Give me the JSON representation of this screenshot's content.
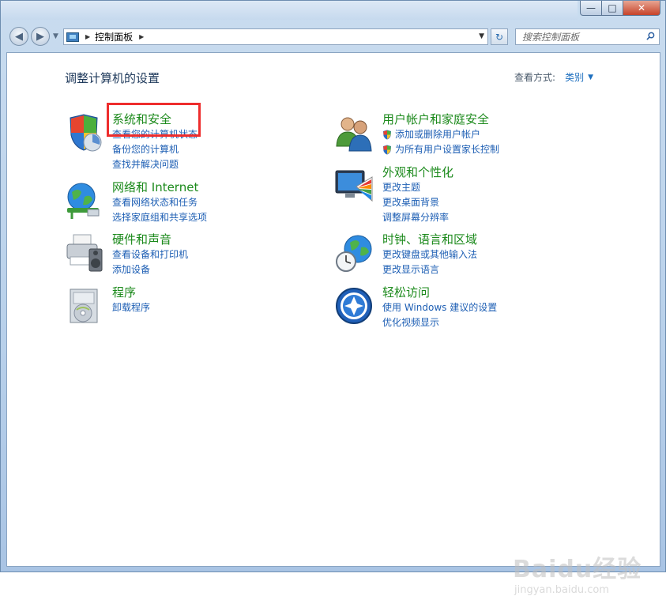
{
  "window": {
    "caption_buttons": {
      "minimize_icon": "minimize-icon",
      "maximize_icon": "maximize-icon",
      "close_icon": "close-icon"
    }
  },
  "address_bar": {
    "location": "控制面板",
    "location_icon": "control-panel-icon"
  },
  "search": {
    "placeholder": "搜索控制面板"
  },
  "main": {
    "title": "调整计算机的设置",
    "view_by_label": "查看方式:",
    "view_by_value": "类别"
  },
  "categories": [
    {
      "title": "系统和安全",
      "icon": "shield-icon",
      "links": [
        {
          "label": "查看您的计算机状态",
          "shield": false
        },
        {
          "label": "备份您的计算机",
          "shield": false
        },
        {
          "label": "查找并解决问题",
          "shield": false
        }
      ]
    },
    {
      "title": "网络和 Internet",
      "icon": "network-globe-icon",
      "links": [
        {
          "label": "查看网络状态和任务",
          "shield": false
        },
        {
          "label": "选择家庭组和共享选项",
          "shield": false
        }
      ]
    },
    {
      "title": "硬件和声音",
      "icon": "printer-speaker-icon",
      "links": [
        {
          "label": "查看设备和打印机",
          "shield": false
        },
        {
          "label": "添加设备",
          "shield": false
        }
      ]
    },
    {
      "title": "程序",
      "icon": "programs-disc-icon",
      "links": [
        {
          "label": "卸载程序",
          "shield": false
        }
      ]
    },
    {
      "title": "用户帐户和家庭安全",
      "icon": "users-icon",
      "links": [
        {
          "label": "添加或删除用户帐户",
          "shield": true
        },
        {
          "label": "为所有用户设置家长控制",
          "shield": true
        }
      ]
    },
    {
      "title": "外观和个性化",
      "icon": "monitor-palette-icon",
      "links": [
        {
          "label": "更改主题",
          "shield": false
        },
        {
          "label": "更改桌面背景",
          "shield": false
        },
        {
          "label": "调整屏幕分辨率",
          "shield": false
        }
      ]
    },
    {
      "title": "时钟、语言和区域",
      "icon": "clock-globe-icon",
      "links": [
        {
          "label": "更改键盘或其他输入法",
          "shield": false
        },
        {
          "label": "更改显示语言",
          "shield": false
        }
      ]
    },
    {
      "title": "轻松访问",
      "icon": "ease-of-access-icon",
      "links": [
        {
          "label": "使用 Windows 建议的设置",
          "shield": false
        },
        {
          "label": "优化视频显示",
          "shield": false
        }
      ]
    }
  ],
  "watermark": {
    "logo": "Baidu经验",
    "url": "jingyan.baidu.com"
  },
  "colors": {
    "category_title": "#1c8a1c",
    "link": "#1e5fb4",
    "highlight_box": "#ee2d2d"
  }
}
